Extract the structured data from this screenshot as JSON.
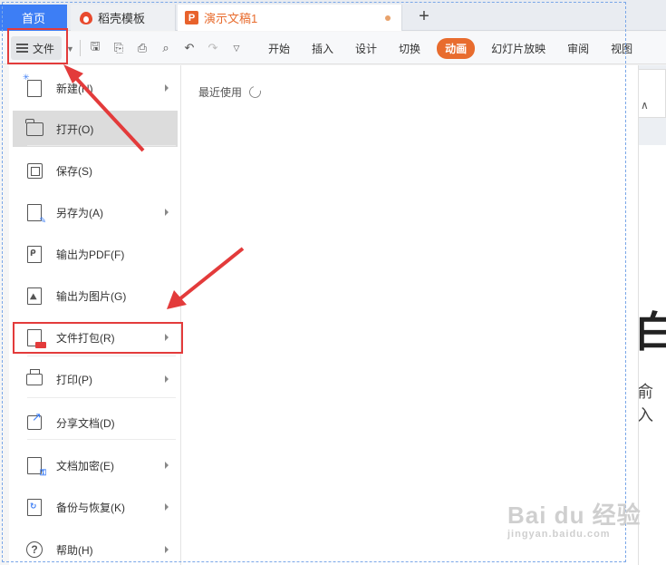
{
  "tabbar": {
    "home": "首页",
    "templates": "稻壳模板",
    "document": "演示文稿1",
    "add": "+"
  },
  "toolbar": {
    "file_label": "文件",
    "ribbon_tabs": [
      {
        "label": "开始",
        "active": false
      },
      {
        "label": "插入",
        "active": false
      },
      {
        "label": "设计",
        "active": false
      },
      {
        "label": "切换",
        "active": false
      },
      {
        "label": "动画",
        "active": true
      },
      {
        "label": "幻灯片放映",
        "active": false
      },
      {
        "label": "审阅",
        "active": false
      },
      {
        "label": "视图",
        "active": false
      }
    ]
  },
  "file_menu": {
    "items": [
      {
        "label": "新建(N)",
        "icon": "new-file-icon",
        "submenu": true,
        "highlighted": false,
        "boxed": false
      },
      {
        "label": "打开(O)",
        "icon": "folder-icon",
        "submenu": false,
        "highlighted": true,
        "boxed": false
      },
      {
        "label": "保存(S)",
        "icon": "save-icon",
        "submenu": false,
        "highlighted": false,
        "boxed": false
      },
      {
        "label": "另存为(A)",
        "icon": "save-as-icon",
        "submenu": true,
        "highlighted": false,
        "boxed": false
      },
      {
        "label": "输出为PDF(F)",
        "icon": "export-pdf-icon",
        "submenu": false,
        "highlighted": false,
        "boxed": false
      },
      {
        "label": "输出为图片(G)",
        "icon": "export-image-icon",
        "submenu": false,
        "highlighted": false,
        "boxed": false
      },
      {
        "label": "文件打包(R)",
        "icon": "package-icon",
        "submenu": true,
        "highlighted": false,
        "boxed": true
      },
      {
        "label": "打印(P)",
        "icon": "print-icon",
        "submenu": true,
        "highlighted": false,
        "boxed": false
      },
      {
        "label": "分享文档(D)",
        "icon": "share-icon",
        "submenu": false,
        "highlighted": false,
        "boxed": false
      },
      {
        "label": "文档加密(E)",
        "icon": "encrypt-icon",
        "submenu": true,
        "highlighted": false,
        "boxed": false
      },
      {
        "label": "备份与恢复(K)",
        "icon": "backup-icon",
        "submenu": true,
        "highlighted": false,
        "boxed": false
      },
      {
        "label": "帮助(H)",
        "icon": "help-icon",
        "submenu": true,
        "highlighted": false,
        "boxed": false
      }
    ]
  },
  "recent": {
    "title": "最近使用"
  },
  "doc_preview": {
    "big_text": "白",
    "sub_text": "俞入"
  },
  "watermark": {
    "main": "Bai du 经验",
    "sub": "jingyan.baidu.com"
  },
  "colors": {
    "accent_blue": "#3d7ef5",
    "accent_orange": "#e86c2e",
    "annotation_red": "#e33b3b"
  }
}
